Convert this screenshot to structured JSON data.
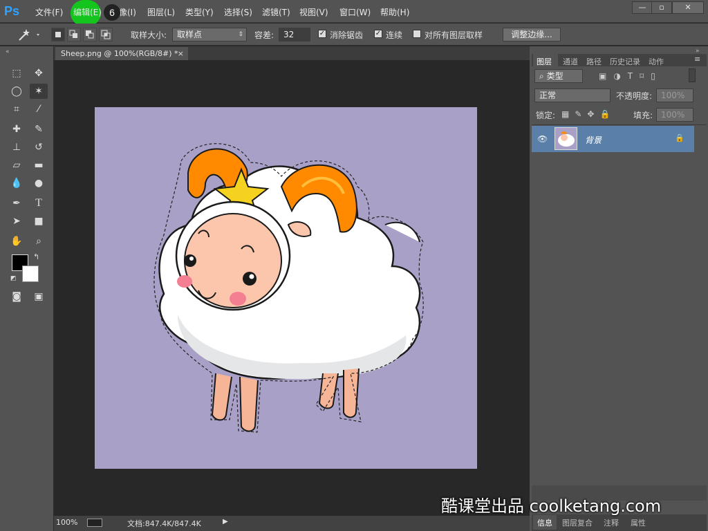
{
  "app": {
    "logo": "Ps"
  },
  "menu": {
    "items": [
      "文件(F)",
      "编辑(E)",
      "图像(I)",
      "图层(L)",
      "类型(Y)",
      "选择(S)",
      "滤镜(T)",
      "视图(V)",
      "窗口(W)",
      "帮助(H)"
    ],
    "highlight_step": "6"
  },
  "window_controls": {
    "minimize": "—",
    "maximize": "▫",
    "close": "✕"
  },
  "options": {
    "sample_size_label": "取样大小:",
    "sample_size_value": "取样点",
    "tolerance_label": "容差:",
    "tolerance_value": "32",
    "anti_alias_label": "消除锯齿",
    "anti_alias_checked": true,
    "contiguous_label": "连续",
    "contiguous_checked": true,
    "sample_all_layers_label": "对所有图层取样",
    "sample_all_layers_checked": false,
    "refine_edge_button": "调整边缘..."
  },
  "document": {
    "tab_title": "Sheep.png @ 100%(RGB/8#) *",
    "zoom": "100%",
    "doc_info": "文档:847.4K/847.4K",
    "background_color": "#a8a0c6"
  },
  "panels": {
    "tabs": [
      "图层",
      "通道",
      "路径",
      "历史记录",
      "动作"
    ],
    "active_tab": "图层",
    "filter_kind": "类型",
    "blend_mode": "正常",
    "opacity_label": "不透明度:",
    "opacity_value": "100%",
    "lock_label": "锁定:",
    "fill_label": "填充:",
    "fill_value": "100%",
    "layer_name": "背景",
    "bottom_tabs": [
      "信息",
      "图层复合",
      "注释",
      "属性"
    ]
  },
  "watermark": "酷课堂出品 coolketang.com",
  "colors": {
    "accent": "#2fa3ff",
    "highlight_green": "#13c51c",
    "layer_selected": "#5a7fa8"
  }
}
